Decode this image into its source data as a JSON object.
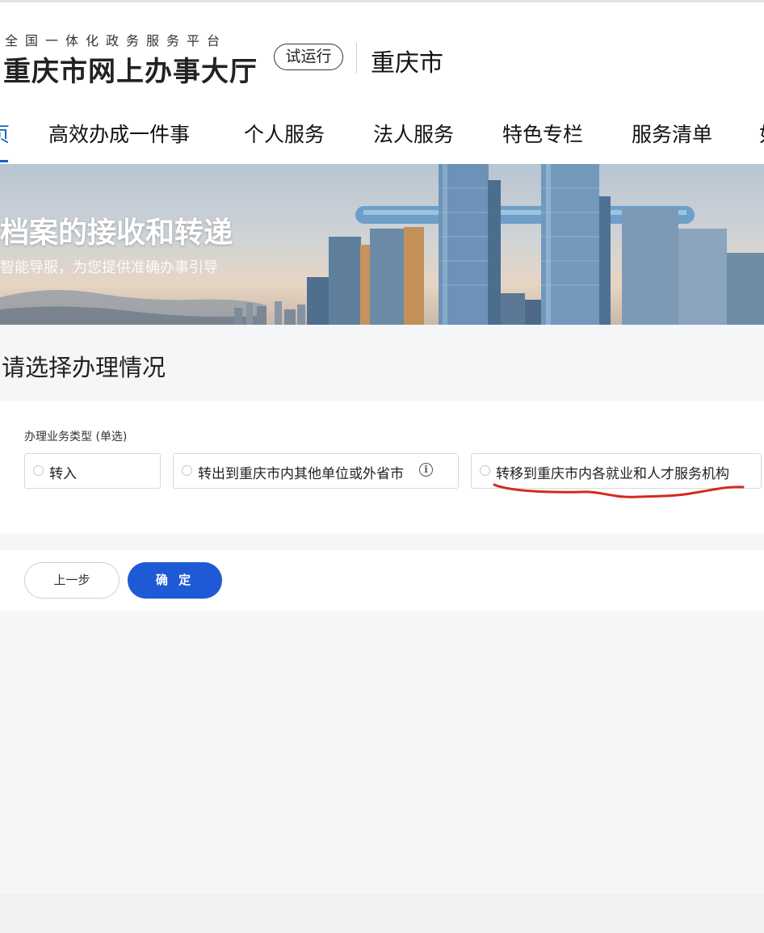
{
  "header": {
    "platform_tagline": "全国一体化政务服务平台",
    "site_name": "重庆市网上办事大厅",
    "trial_badge": "试运行",
    "city": "重庆市"
  },
  "nav": {
    "items": [
      {
        "label": "页"
      },
      {
        "label": "高效办成一件事"
      },
      {
        "label": "个人服务"
      },
      {
        "label": "法人服务"
      },
      {
        "label": "特色专栏"
      },
      {
        "label": "服务清单"
      },
      {
        "label": "如"
      }
    ],
    "active_color": "#1565c0"
  },
  "banner": {
    "title": "档案的接收和转递",
    "subtitle": "智能导服，为您提供准确办事引导"
  },
  "section": {
    "title": "请选择办理情况"
  },
  "form": {
    "field_label": "办理业务类型 (单选)",
    "options": [
      {
        "label": "转入",
        "selected": false
      },
      {
        "label": "转出到重庆市内其他单位或外省市",
        "selected": false,
        "icon": "info-icon"
      },
      {
        "label": "转移到重庆市内各就业和人才服务机构",
        "selected": false,
        "annotated": true
      }
    ]
  },
  "actions": {
    "prev_label": "上一步",
    "confirm_label": "确 定"
  },
  "colors": {
    "primary_button": "#1f5ad6",
    "annotation_stroke": "#d42a1e"
  }
}
